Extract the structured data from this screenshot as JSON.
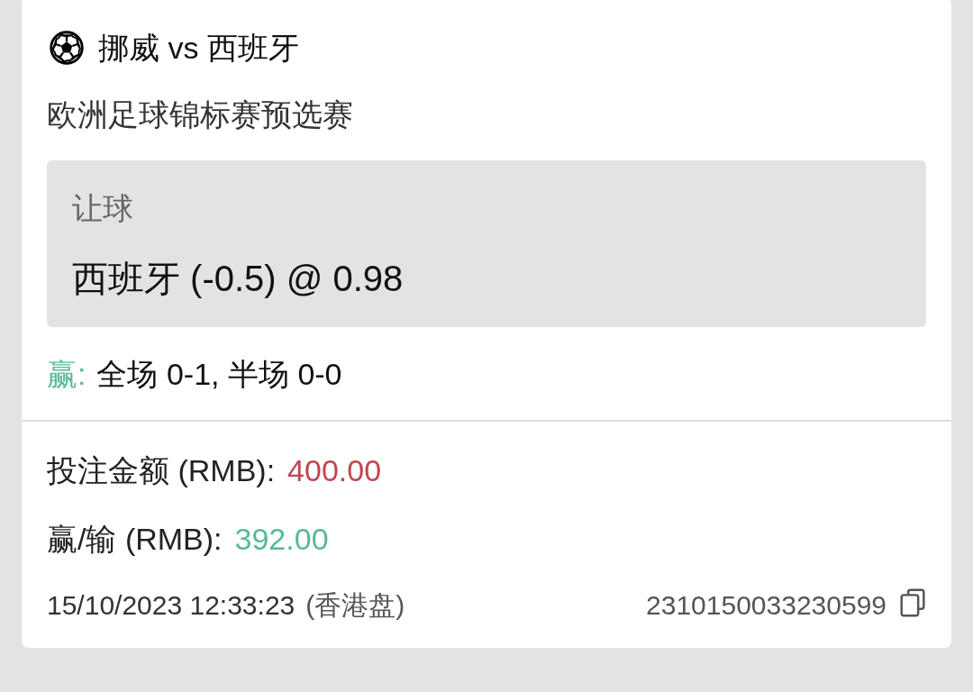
{
  "match": {
    "title": "挪威 vs 西班牙",
    "competition": "欧洲足球锦标赛预选赛"
  },
  "selection": {
    "market": "让球",
    "pick": "西班牙 (-0.5) @ 0.98"
  },
  "result": {
    "won": true,
    "label": "赢:",
    "score": "全场 0-1, 半场 0-0"
  },
  "amounts": [
    {
      "label": "投注金额 (RMB):",
      "value": "400.00",
      "color": "#c1464f"
    },
    {
      "label": "赢/输 (RMB):",
      "value": "392.00",
      "color": "#58bb93"
    }
  ],
  "footer": {
    "placed_at": "15/10/2023 12:33:23",
    "odds_type": "(香港盘)",
    "ticket_id": "2310150033230599"
  }
}
